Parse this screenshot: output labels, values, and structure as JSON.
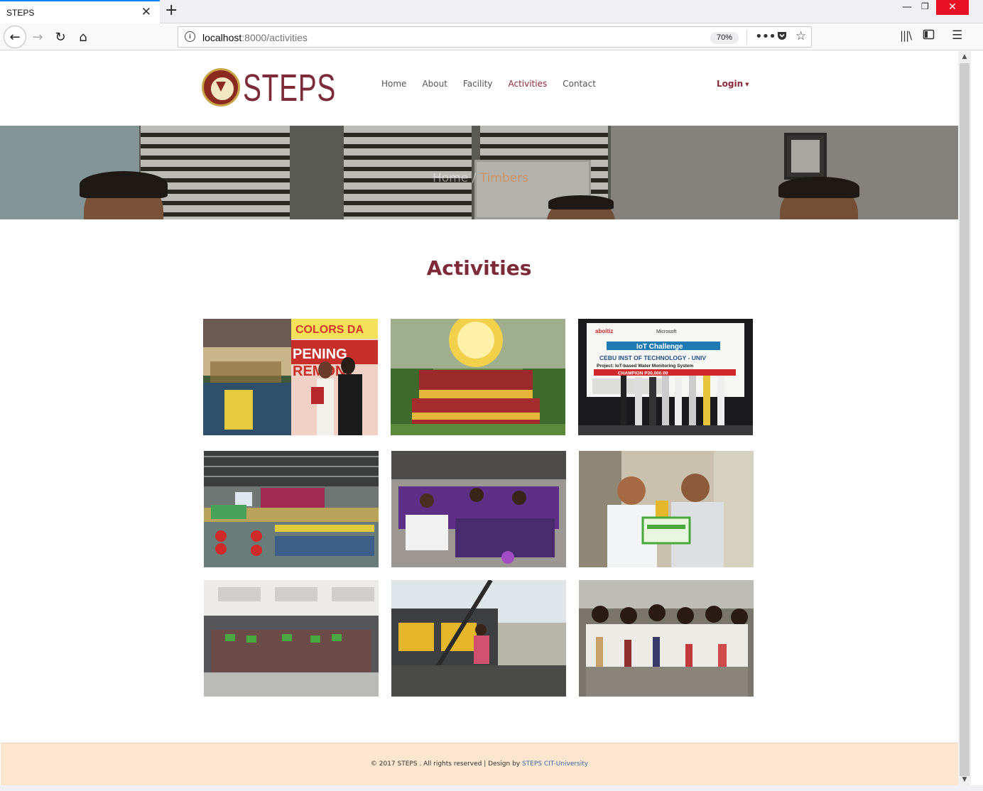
{
  "browser": {
    "tab_title": "STEPS",
    "url_host": "localhost",
    "url_rest": ":8000/activities",
    "zoom": "70%"
  },
  "site": {
    "logo_text": "STEPS",
    "nav": [
      "Home",
      "About",
      "Facility",
      "Activities",
      "Contact"
    ],
    "active_nav": "Activities",
    "login_label": "Login"
  },
  "hero": {
    "breadcrumb_home": "Home",
    "breadcrumb_sep": " / ",
    "breadcrumb_current": "Timbers"
  },
  "main": {
    "title": "Activities",
    "photos": [
      {
        "name": "colors-day-opening-ceremony",
        "caption_lines": [
          "COLORS DA",
          "PENING",
          "REMONY"
        ]
      },
      {
        "name": "team-photo-seal",
        "caption_lines": []
      },
      {
        "name": "iot-challenge-champion",
        "caption_lines": [
          "IoT Challenge",
          "CEBU INST OF TECHNOLOGY - UNIV",
          "Project: IoT-based Water Monitoring System",
          "CHAMPION    P30,000.00"
        ]
      },
      {
        "name": "gymnasium-event",
        "caption_lines": []
      },
      {
        "name": "purple-shirts-group",
        "caption_lines": []
      },
      {
        "name": "award-trophy",
        "caption_lines": []
      },
      {
        "name": "group-certificates",
        "caption_lines": []
      },
      {
        "name": "performer-on-stage",
        "caption_lines": []
      },
      {
        "name": "students-with-banners",
        "caption_lines": []
      }
    ]
  },
  "footer": {
    "text": "© 2017 STEPS . All rights reserved | Design by ",
    "link": "STEPS CIT-University"
  },
  "colors": {
    "brand_maroon": "#7d2b38",
    "footer_bg": "#fce6cf",
    "footer_link": "#3a6aa8"
  }
}
